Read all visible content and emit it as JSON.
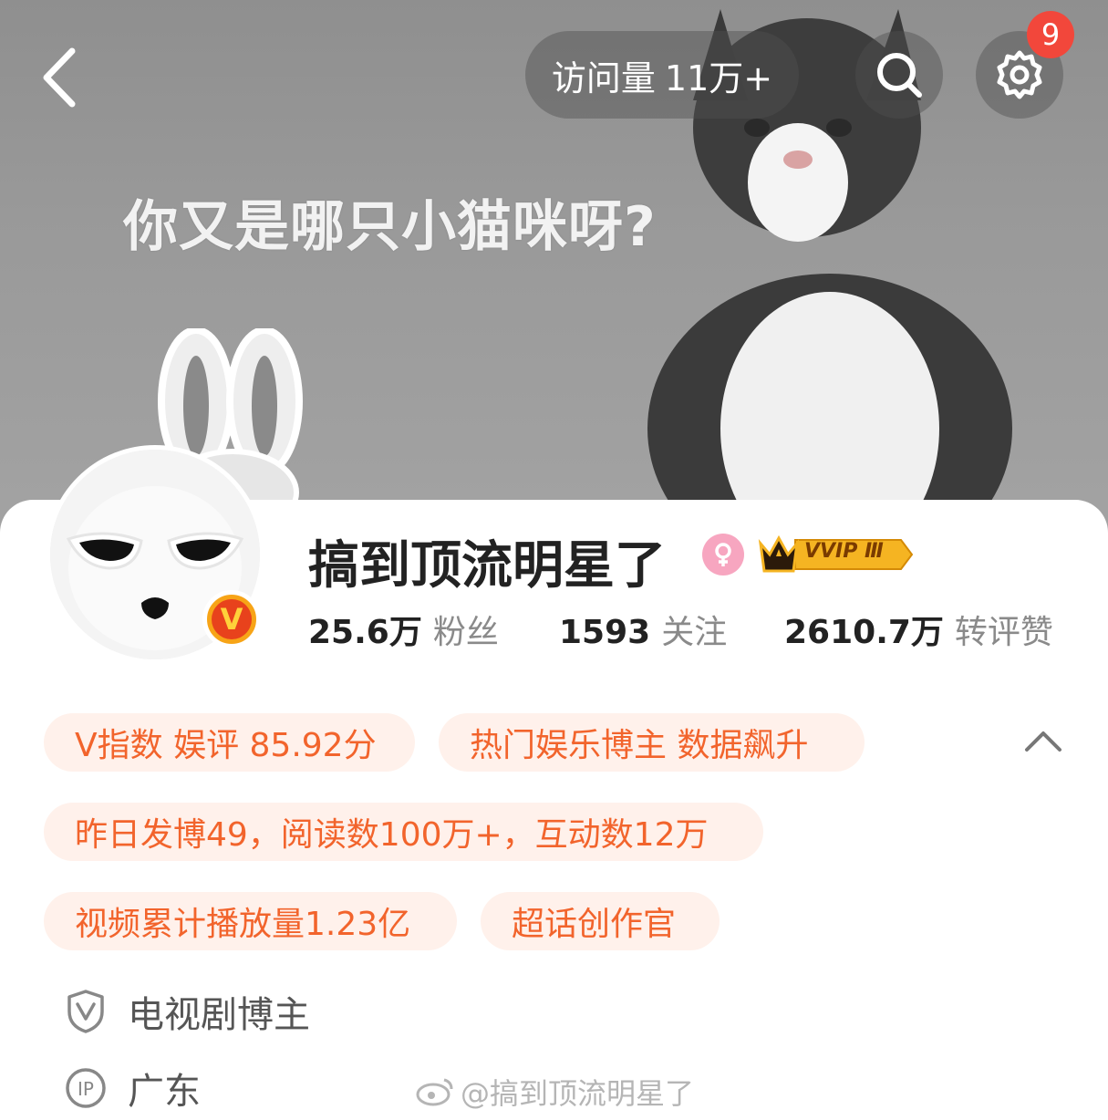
{
  "header": {
    "visits_label": "访问量",
    "visits_value": "11万+",
    "notification_count": "9",
    "cover_caption": "你又是哪只小猫咪呀?"
  },
  "profile": {
    "username": "搞到顶流明星了",
    "verified_badge": "V",
    "vip_label": "VVIP Ⅲ",
    "stats": [
      {
        "value": "25.6万",
        "label": "粉丝"
      },
      {
        "value": "1593",
        "label": "关注"
      },
      {
        "value": "2610.7万",
        "label": "转评赞"
      }
    ]
  },
  "tags": [
    "V指数 娱评 85.92分",
    "热门娱乐博主 数据飙升",
    "昨日发博49，阅读数100万+，互动数12万",
    "视频累计播放量1.23亿",
    "超话创作官"
  ],
  "info": {
    "category": "电视剧博主",
    "ip_location": "广东"
  },
  "watermark": "@搞到顶流明星了",
  "colors": {
    "accent": "#f2642c",
    "tag_bg": "#fff1eb",
    "badge_red": "#f2473b",
    "vip_gold": "#f5b422"
  }
}
